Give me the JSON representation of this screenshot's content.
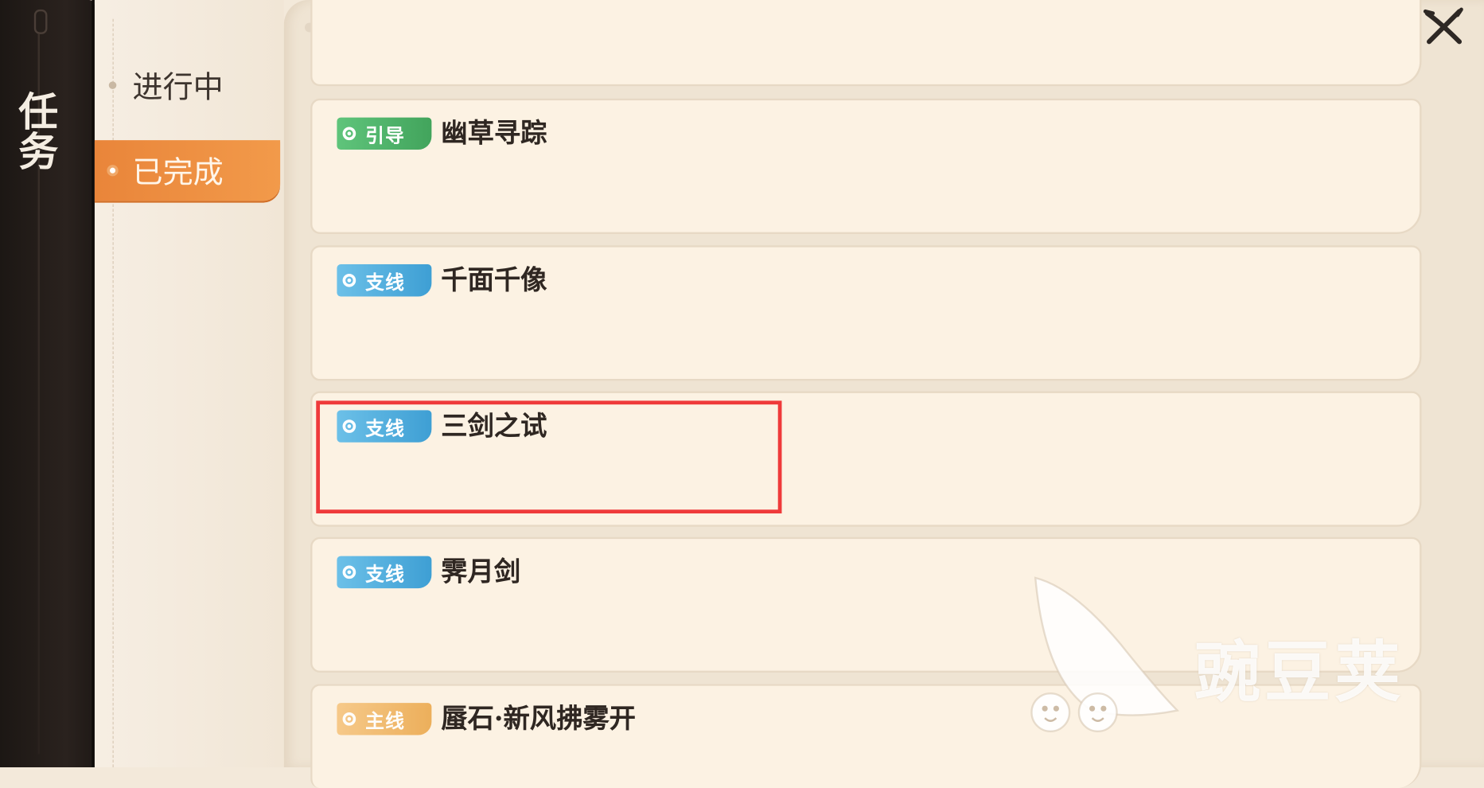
{
  "panel": {
    "title": "任务"
  },
  "tabs": [
    {
      "label": "进行中",
      "active": false
    },
    {
      "label": "已完成",
      "active": true
    }
  ],
  "quests": [
    {
      "tag": "引导",
      "tag_color": "#4fb46a",
      "title": "幽草寻踪"
    },
    {
      "tag": "支线",
      "tag_color": "#4aa8dc",
      "title": "千面千像"
    },
    {
      "tag": "支线",
      "tag_color": "#4aa8dc",
      "title": "三剑之试",
      "highlighted": true
    },
    {
      "tag": "支线",
      "tag_color": "#4aa8dc",
      "title": "霁月剑"
    },
    {
      "tag": "主线",
      "tag_color": "#eeaf55",
      "title": "蜃石·新风拂雾开"
    }
  ],
  "highlight_color": "#ef3a3a",
  "watermark": {
    "text": "豌豆荚"
  },
  "icons": {
    "close": "close-x-icon"
  }
}
